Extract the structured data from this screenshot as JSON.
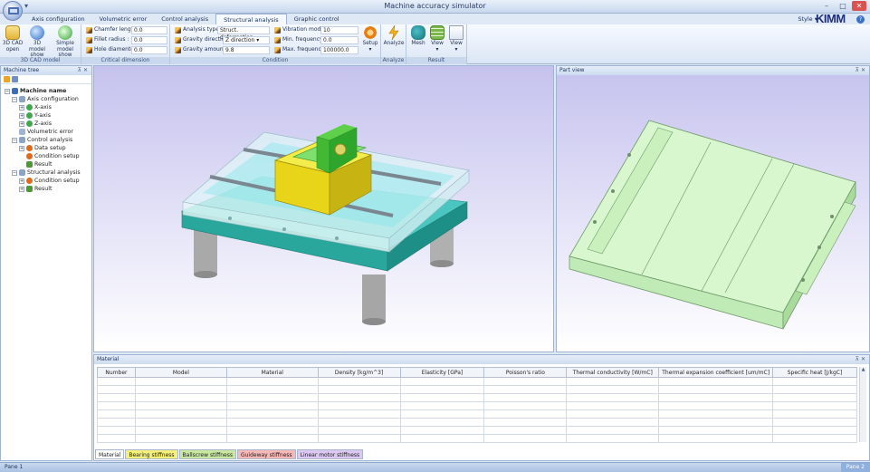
{
  "window": {
    "title": "Machine accuracy simulator",
    "qat_icon": "quick-access-dropdown"
  },
  "tabs": [
    {
      "label": "Axis configuration"
    },
    {
      "label": "Volumetric error"
    },
    {
      "label": "Control analysis"
    },
    {
      "label": "Structural analysis"
    },
    {
      "label": "Graphic control"
    }
  ],
  "header_right": {
    "style_label": "Style",
    "logo_text": "KIMM"
  },
  "ribbon": {
    "cad_group": {
      "label": "3D CAD model",
      "buttons": [
        {
          "label": "3D CAD open",
          "icon": "cad-folder-icon"
        },
        {
          "label": "3D model show",
          "icon": "globe-icon"
        },
        {
          "label": "Simple model show",
          "icon": "globe-green-icon"
        }
      ]
    },
    "dimension_group": {
      "label": "Critical dimension",
      "fields": [
        {
          "label": "Chamfer length :",
          "value": "0.0"
        },
        {
          "label": "Fillet radius :",
          "value": "0.0"
        },
        {
          "label": "Hole diamenter :",
          "value": "0.0"
        }
      ]
    },
    "condition_group": {
      "label": "Condition",
      "fields_left": [
        {
          "label": "Analysis type :",
          "value": "Struct. deformation"
        },
        {
          "label": "Gravity direction :",
          "value": "Z direction"
        },
        {
          "label": "Gravity amount :",
          "value": "9.8"
        }
      ],
      "fields_right": [
        {
          "label": "Vibration mode :",
          "value": "10"
        },
        {
          "label": "Min. frequency :",
          "value": "0.0"
        },
        {
          "label": "Max. frequency :",
          "value": "100000.0"
        }
      ],
      "setup_label": "Setup"
    },
    "analyze_group": {
      "label": "Analyze",
      "button": "Analyze"
    },
    "result_group": {
      "label": "Result",
      "buttons": [
        {
          "label": "Mesh"
        },
        {
          "label": "View"
        },
        {
          "label": "View"
        }
      ]
    }
  },
  "machine_tree": {
    "title": "Machine tree",
    "root": "Machine name",
    "items": [
      {
        "label": "Axis configuration"
      },
      {
        "label": "X-axis"
      },
      {
        "label": "Y-axis"
      },
      {
        "label": "Z-axis"
      },
      {
        "label": "Volumetric error"
      },
      {
        "label": "Control analysis"
      },
      {
        "label": "Data setup"
      },
      {
        "label": "Condition setup"
      },
      {
        "label": "Result"
      },
      {
        "label": "Structural analysis"
      },
      {
        "label": "Condition setup"
      },
      {
        "label": "Result"
      }
    ]
  },
  "part_view": {
    "title": "Part view"
  },
  "material": {
    "title": "Material",
    "columns": [
      "Number",
      "Model",
      "Material",
      "Density [kg/m^3]",
      "Elasticity [GPa]",
      "Poisson's ratio",
      "Thermal conductivity [W/mC]",
      "Thermal expansion coefficient [um/mC]",
      "Specific heat [J/kgC]"
    ],
    "tabs": [
      {
        "label": "Material",
        "color": "#ffffff"
      },
      {
        "label": "Bearing stiffness",
        "color": "#f4f07a"
      },
      {
        "label": "Ballscrew stiffness",
        "color": "#c8e8a0"
      },
      {
        "label": "Guideway stiffness",
        "color": "#f7b8b8"
      },
      {
        "label": "Linear motor stiffness",
        "color": "#dcc8f2"
      }
    ]
  },
  "status": {
    "left": "Pane 1",
    "right": "Pane 2"
  }
}
